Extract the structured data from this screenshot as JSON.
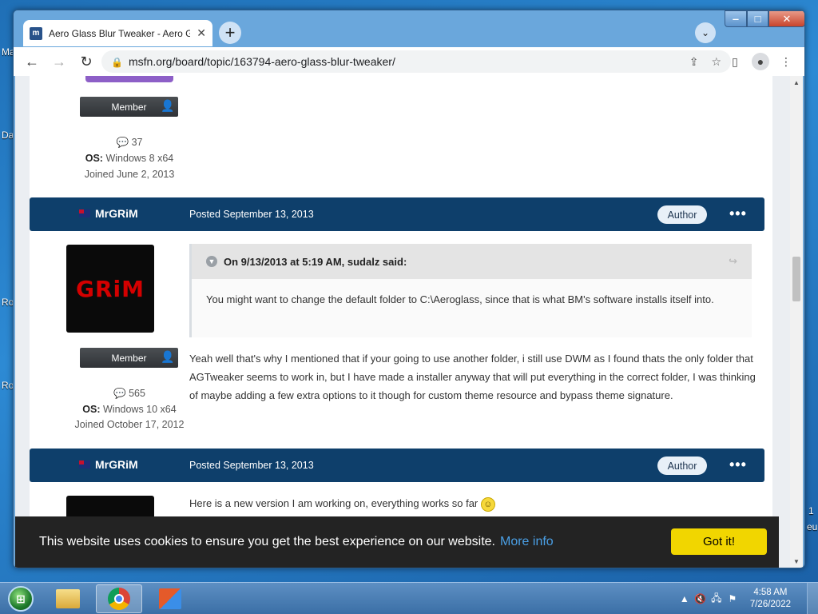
{
  "desktop": {
    "left_labels": [
      "Ma",
      "Da",
      "Ro",
      "Ro"
    ],
    "right_labels": [
      "1",
      "eu"
    ]
  },
  "browser": {
    "tab_title": "Aero Glass Blur Tweaker - Aero G",
    "favicon_letter": "m",
    "url": "msfn.org/board/topic/163794-aero-glass-blur-tweaker/"
  },
  "first_author": {
    "badge": "Member",
    "posts": "37",
    "os_label": "OS:",
    "os_value": "Windows 8 x64",
    "joined": "Joined June 2, 2013"
  },
  "posts": [
    {
      "author": "MrGRiM",
      "date": "Posted September 13, 2013",
      "role_badge": "Author",
      "avatar_text": "GRiM",
      "member_badge": "Member",
      "posts": "565",
      "os_label": "OS:",
      "os_value": "Windows 10 x64",
      "joined": "Joined October 17, 2012",
      "quote_header": "On 9/13/2013 at 5:19 AM, sudalz said:",
      "quote_text": "You might want to change the default folder to C:\\Aeroglass, since that is what BM's software installs itself into.",
      "text": "Yeah well that's why I mentioned that if your going to use another folder, i still use DWM as I found thats the only folder that AGTweaker seems to work in, but I have made a installer anyway that will put everything in the correct folder, I was thinking of maybe adding a few extra options to it though for custom theme resource and bypass theme signature."
    },
    {
      "author": "MrGRiM",
      "date": "Posted September 13, 2013",
      "role_badge": "Author",
      "text": "Here is a new version I am working on, everything works so far"
    }
  ],
  "cookie": {
    "message": "This website uses cookies to ensure you get the best experience on our website.",
    "more_info": "More info",
    "button": "Got it!"
  },
  "taskbar": {
    "time": "4:58 AM",
    "date": "7/26/2022"
  },
  "colors": {
    "post_header": "#0e3f6b",
    "cookie_bg": "#232323",
    "cookie_button": "#f1d600",
    "link": "#4a9fe5"
  }
}
